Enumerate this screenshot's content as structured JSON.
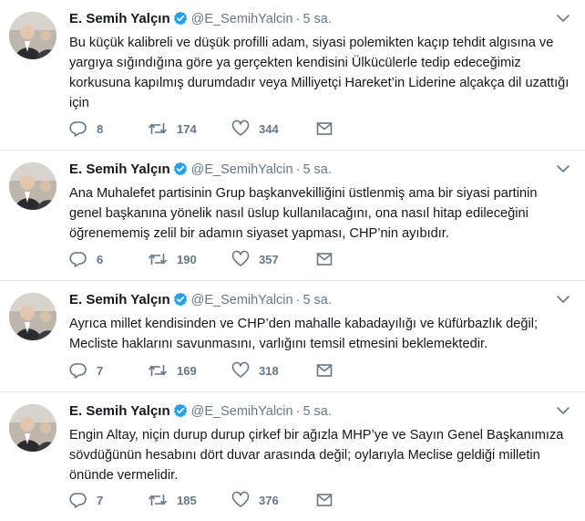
{
  "tweets": [
    {
      "name": "E. Semih Yalçın",
      "handle": "@E_SemihYalcin",
      "separator": "·",
      "time": "5 sa.",
      "text": "Bu küçük kalibreli ve düşük profilli adam, siyasi polemikten kaçıp tehdit algısına ve yargıya sığındığına göre ya gerçekten kendisini Ülkücülerle tedip edeceğimiz korkusuna kapılmış durumdadır veya Milliyetçi Hareket’in Liderine alçakça dil uzattığı için",
      "replies": "8",
      "retweets": "174",
      "likes": "344"
    },
    {
      "name": "E. Semih Yalçın",
      "handle": "@E_SemihYalcin",
      "separator": "·",
      "time": "5 sa.",
      "text": "Ana Muhalefet partisinin Grup başkanvekilliğini üstlenmiş ama bir siyasi partinin genel başkanına yönelik nasıl üslup kullanılacağını, ona nasıl hitap edileceğini öğrenememiş zelil bir adamın siyaset yapması, CHP’nin ayıbıdır.",
      "replies": "6",
      "retweets": "190",
      "likes": "357"
    },
    {
      "name": "E. Semih Yalçın",
      "handle": "@E_SemihYalcin",
      "separator": "·",
      "time": "5 sa.",
      "text": "Ayrıca millet kendisinden ve CHP’den mahalle kabadayılığı ve küfürbazlık değil; Mecliste haklarını savunmasını, varlığını temsil etmesini beklemektedir.",
      "replies": "7",
      "retweets": "169",
      "likes": "318"
    },
    {
      "name": "E. Semih Yalçın",
      "handle": "@E_SemihYalcin",
      "separator": "·",
      "time": "5 sa.",
      "text": "Engin Altay, niçin durup durup çirkef bir ağızla MHP’ye ve Sayın Genel Başkanımıza sövdüğünün hesabını dört duvar arasında değil; oylarıyla Meclise geldiği milletin önünde vermelidir.",
      "replies": "7",
      "retweets": "185",
      "likes": "376"
    }
  ],
  "icons": {
    "verified": "verified-badge-icon",
    "caret": "chevron-down-icon",
    "reply": "reply-icon",
    "retweet": "retweet-icon",
    "like": "heart-icon",
    "message": "envelope-icon"
  },
  "colors": {
    "verified": "#1da1f2",
    "muted": "#657786",
    "text": "#14171a",
    "divider": "#e6ecf0"
  }
}
